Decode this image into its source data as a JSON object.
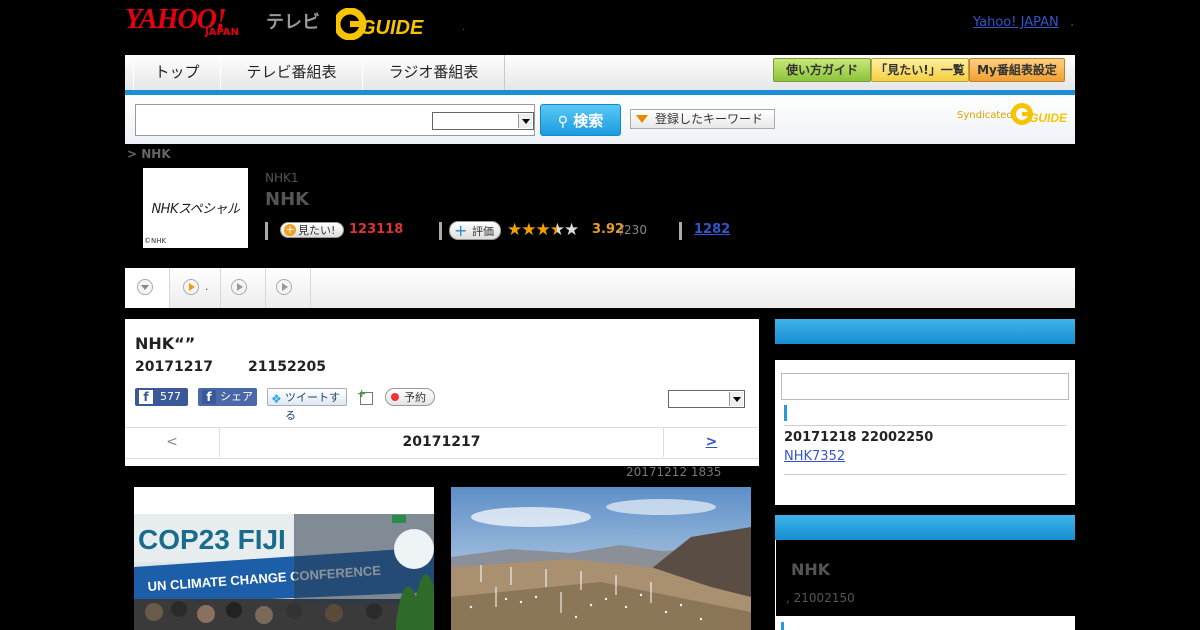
{
  "header": {
    "logo_yahoo": "YAHOO!",
    "logo_japan": "JAPAN",
    "logo_tv": "テレビ",
    "logo_gguide": "GUIDE",
    "yahoo_japan_link": "Yahoo! JAPAN",
    "dot": "."
  },
  "nav": {
    "tabs": [
      "トップ",
      "テレビ番組表",
      "ラジオ番組表"
    ],
    "buttons": [
      "使い方ガイド",
      "「見たい!」一覧",
      "My番組表設定"
    ]
  },
  "search": {
    "button_label": "検索",
    "keyword_button": "登録したキーワード",
    "syndicated": "Syndicated"
  },
  "program": {
    "breadcrumb": "> NHK",
    "thumb_text": "NHKスペシャル",
    "thumb_credit": "©NHK",
    "channel": "NHK1",
    "title": "NHK",
    "mitai_label": "見たい!",
    "mitai_count": "123118",
    "review_label": "評価",
    "rating_value": 3.5,
    "score": "3.92",
    "score_sub": "/230",
    "reviews_link": "1282"
  },
  "subtabs": {
    "tab2_text": "."
  },
  "episode": {
    "title": "NHK“”",
    "date": "20171217",
    "time": "21152205",
    "fb_count": "577",
    "fb_share": "シェア",
    "tweet": "ツイートする",
    "reserve": "予約",
    "pager_prev": "<",
    "pager_date": "20171217",
    "pager_next": ">",
    "updated": "20171212  1835"
  },
  "sidebar": {
    "date": "20171218  22002250",
    "link": "NHK7352     ",
    "program_name": "NHK",
    "program_info": ", 21002150"
  },
  "images": {
    "img1_sign1": "COP23 FIJI",
    "img1_sign2": "UN CLIMATE CHANGE CONFERENCE"
  },
  "colors": {
    "accent_blue": "#1a8fd6",
    "link_blue": "#3355cc",
    "mitai_red": "#dd3333",
    "score_orange": "#e89a2c"
  }
}
